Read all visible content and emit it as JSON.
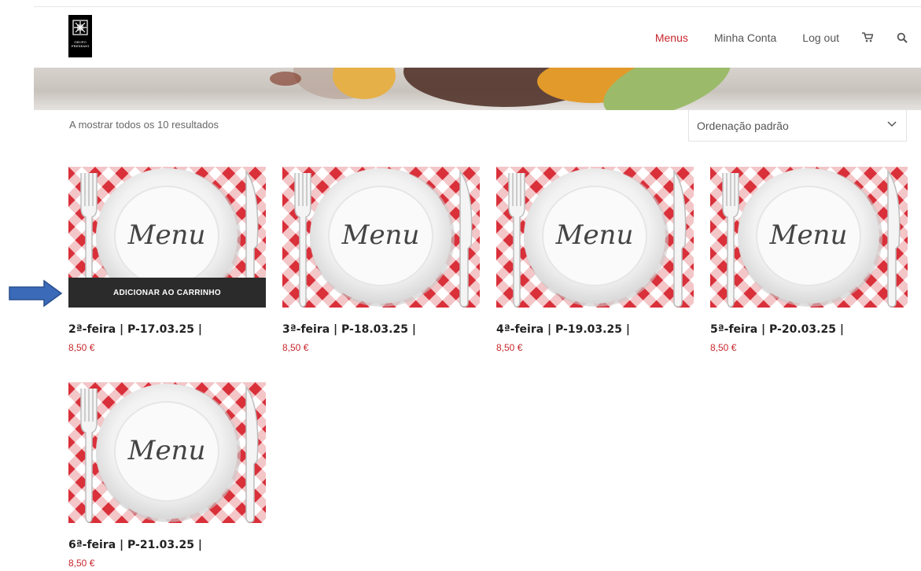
{
  "header": {
    "logo_lines": [
      "GRUPO",
      "FREXEANI"
    ],
    "nav": [
      {
        "label": "Menus",
        "active": true
      },
      {
        "label": "Minha Conta",
        "active": false
      },
      {
        "label": "Log out",
        "active": false
      }
    ],
    "icons": [
      "cart-icon",
      "search-icon"
    ]
  },
  "shop": {
    "result_count": "A mostrar todos os 10 resultados",
    "sort_selected": "Ordenação padrão"
  },
  "products": [
    {
      "title": "2ª-feira | P-17.03.25 |",
      "price": "8,50 €",
      "image_text": "Menu",
      "button": "ADICIONAR AO CARRINHO"
    },
    {
      "title": "3ª-feira | P-18.03.25 |",
      "price": "8,50 €",
      "image_text": "Menu"
    },
    {
      "title": "4ª-feira | P-19.03.25 |",
      "price": "8,50 €",
      "image_text": "Menu"
    },
    {
      "title": "5ª-feira | P-20.03.25 |",
      "price": "8,50 €",
      "image_text": "Menu"
    },
    {
      "title": "6ª-feira | P-21.03.25 |",
      "price": "8,50 €",
      "image_text": "Menu"
    }
  ],
  "colors": {
    "accent": "#c8262c",
    "button_bg": "#2b2b2b",
    "arrow": "#3a6ab8",
    "checker_red": "#d9303a"
  }
}
